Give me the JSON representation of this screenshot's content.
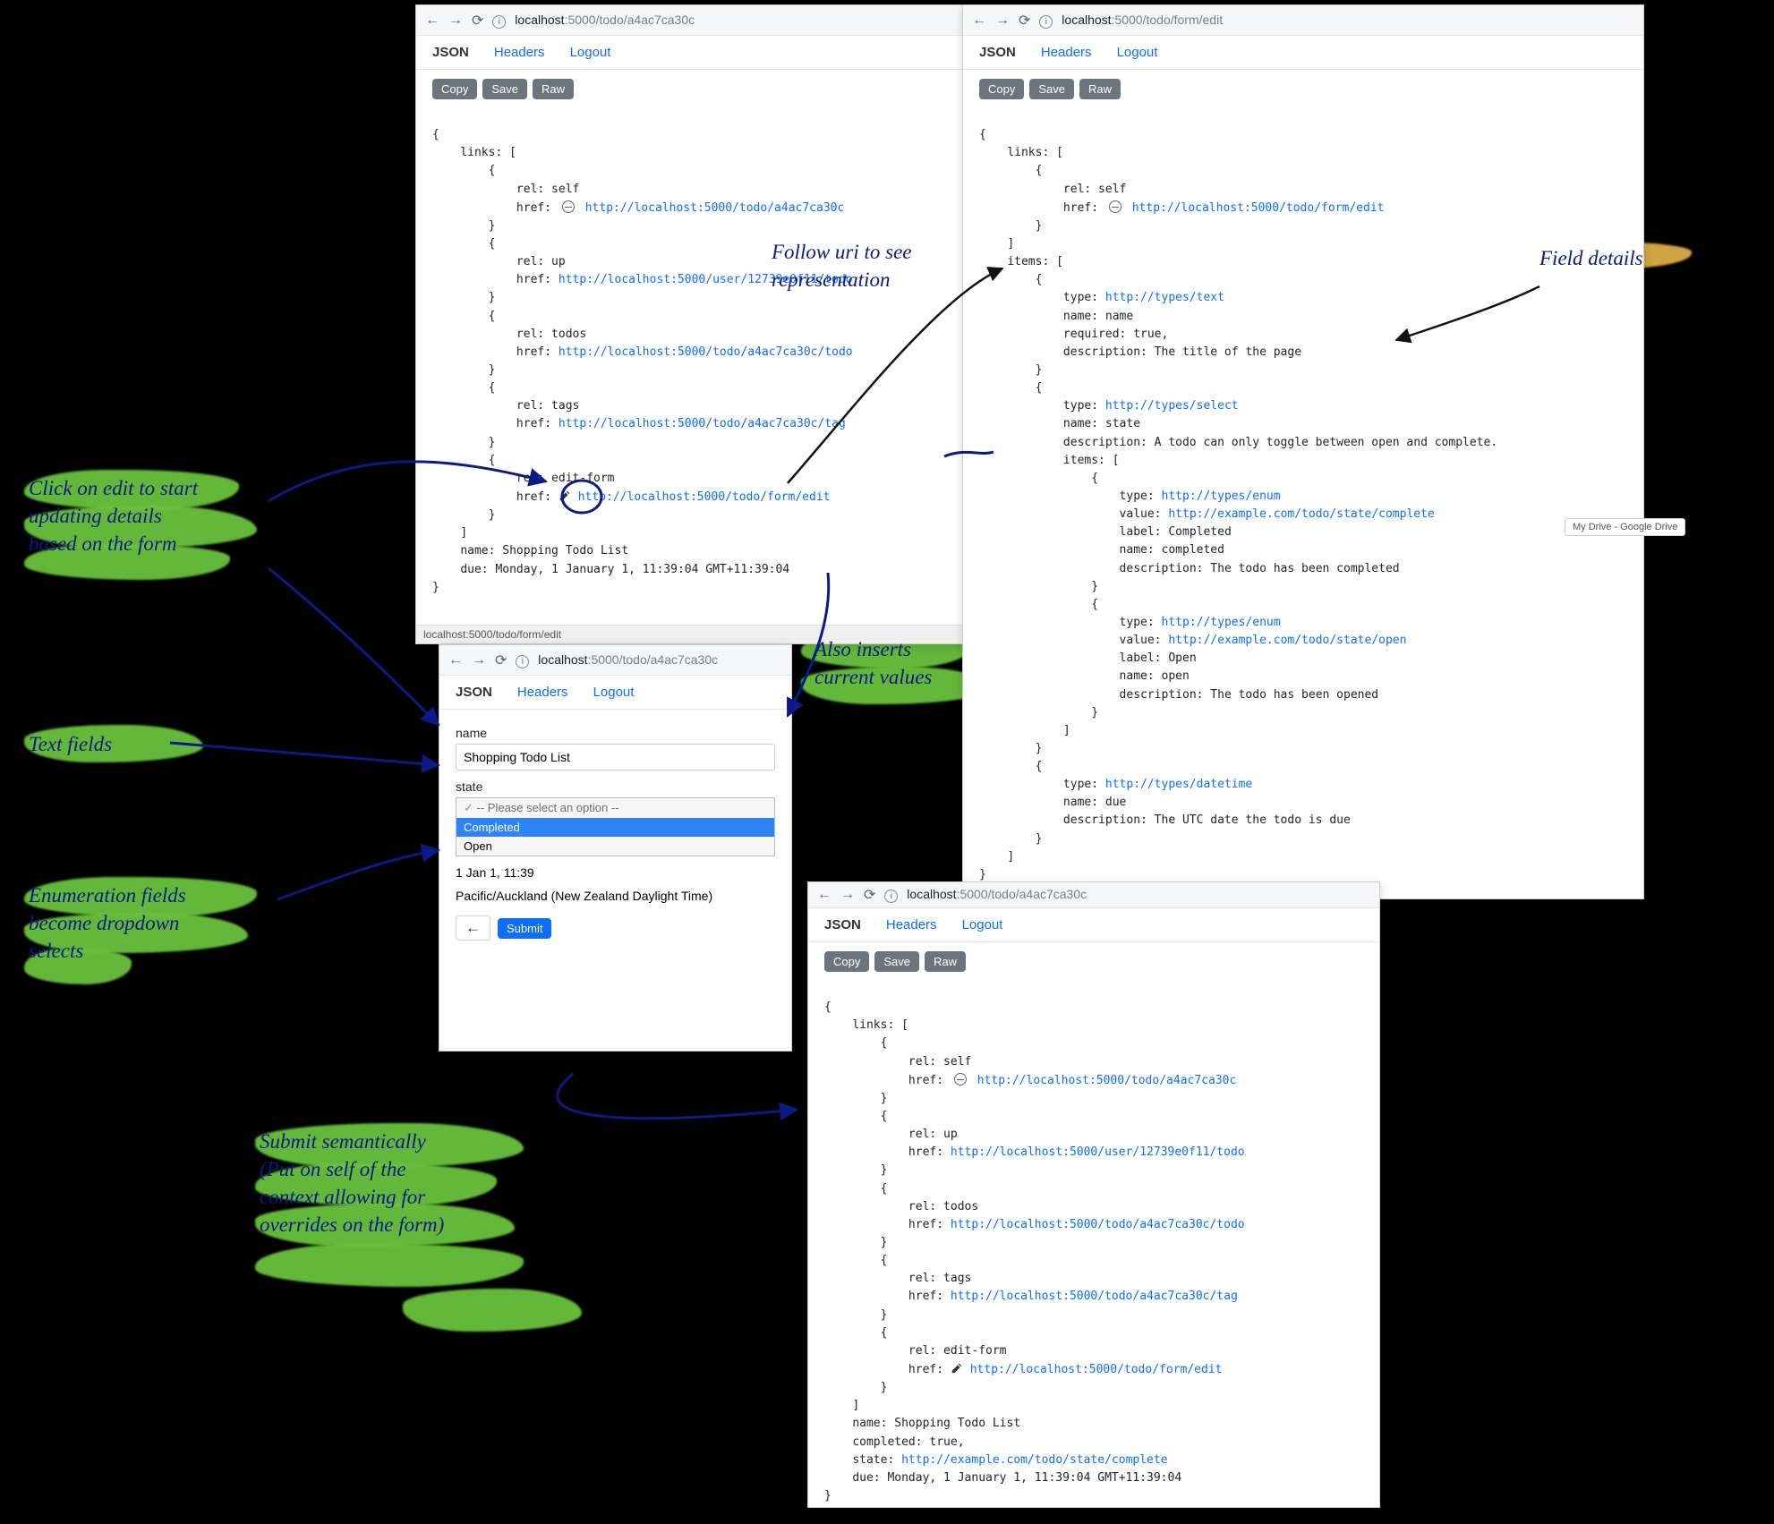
{
  "windows": {
    "w1": {
      "url_host": "localhost",
      "url_path": ":5000/todo/a4ac7ca30c",
      "tabs": {
        "json": "JSON",
        "headers": "Headers",
        "logout": "Logout"
      },
      "buttons": {
        "copy": "Copy",
        "save": "Save",
        "raw": "Raw"
      },
      "json": {
        "open": "{",
        "links_label": "links: [",
        "link_open": "{",
        "link_close": "}",
        "rel_self": "rel: self",
        "href_self_pre": "href:",
        "href_self": "http://localhost:5000/todo/a4ac7ca30c",
        "rel_up": "rel: up",
        "href_up_pre": "href:",
        "href_up": "http://localhost:5000/user/12739e0f11/todo",
        "rel_todos": "rel: todos",
        "href_todos_pre": "href:",
        "href_todos": "http://localhost:5000/todo/a4ac7ca30c/todo",
        "rel_tags": "rel: tags",
        "href_tags_pre": "href:",
        "href_tags": "http://localhost:5000/todo/a4ac7ca30c/tag",
        "rel_edit": "rel: edit-form",
        "href_edit_pre": "href:",
        "href_edit": "http://localhost:5000/todo/form/edit",
        "links_close": "]",
        "name_line": "name: Shopping Todo List",
        "due_line": "due: Monday, 1 January 1, 11:39:04 GMT+11:39:04",
        "close": "}"
      },
      "status": "localhost:5000/todo/form/edit"
    },
    "w2": {
      "url_host": "localhost",
      "url_path": ":5000/todo/form/edit",
      "tabs": {
        "json": "JSON",
        "headers": "Headers",
        "logout": "Logout"
      },
      "buttons": {
        "copy": "Copy",
        "save": "Save",
        "raw": "Raw"
      },
      "json": {
        "open": "{",
        "links_label": "links: [",
        "link_open": "{",
        "link_close": "}",
        "rel_self": "rel: self",
        "href_self_pre": "href:",
        "href_self": "http://localhost:5000/todo/form/edit",
        "links_close": "]",
        "items_label": "items: [",
        "item1_type_pre": "type:",
        "item1_type": "http://types/text",
        "item1_name": "name: name",
        "item1_req": "required: true,",
        "item1_desc": "description: The title of the page",
        "item2_type_pre": "type:",
        "item2_type": "http://types/select",
        "item2_name": "name: state",
        "item2_desc": "description: A todo can only toggle between open and complete.",
        "item2_items_label": "items: [",
        "enum1_type_pre": "type:",
        "enum1_type": "http://types/enum",
        "enum1_value_pre": "value:",
        "enum1_value": "http://example.com/todo/state/complete",
        "enum1_label": "label: Completed",
        "enum1_name": "name: completed",
        "enum1_desc": "description: The todo has been completed",
        "enum2_type_pre": "type:",
        "enum2_type": "http://types/enum",
        "enum2_value_pre": "value:",
        "enum2_value": "http://example.com/todo/state/open",
        "enum2_label": "label: Open",
        "enum2_name": "name: open",
        "enum2_desc": "description: The todo has been opened",
        "item2_items_close": "]",
        "item3_type_pre": "type:",
        "item3_type": "http://types/datetime",
        "item3_name": "name: due",
        "item3_desc": "description: The UTC date the todo is due",
        "items_close": "]",
        "close": "}"
      }
    },
    "w3": {
      "url_host": "localhost",
      "url_path": ":5000/todo/a4ac7ca30c",
      "tabs": {
        "json": "JSON",
        "headers": "Headers",
        "logout": "Logout"
      },
      "form": {
        "name_label": "name",
        "name_value": "Shopping Todo List",
        "state_label": "state",
        "state_placeholder": "-- Please select an option --",
        "state_opt_completed": "Completed",
        "state_opt_open": "Open",
        "date_value": "1 Jan 1, 11:39",
        "tz_value": "Pacific/Auckland (New Zealand Daylight Time)",
        "back_icon": "←",
        "submit": "Submit"
      }
    },
    "w4": {
      "url_host": "localhost",
      "url_path": ":5000/todo/a4ac7ca30c",
      "tabs": {
        "json": "JSON",
        "headers": "Headers",
        "logout": "Logout"
      },
      "buttons": {
        "copy": "Copy",
        "save": "Save",
        "raw": "Raw"
      },
      "json": {
        "open": "{",
        "links_label": "links: [",
        "link_open": "{",
        "link_close": "}",
        "rel_self": "rel: self",
        "href_self_pre": "href:",
        "href_self": "http://localhost:5000/todo/a4ac7ca30c",
        "rel_up": "rel: up",
        "href_up_pre": "href:",
        "href_up": "http://localhost:5000/user/12739e0f11/todo",
        "rel_todos": "rel: todos",
        "href_todos_pre": "href:",
        "href_todos": "http://localhost:5000/todo/a4ac7ca30c/todo",
        "rel_tags": "rel: tags",
        "href_tags_pre": "href:",
        "href_tags": "http://localhost:5000/todo/a4ac7ca30c/tag",
        "rel_edit": "rel: edit-form",
        "href_edit_pre": "href:",
        "href_edit": "http://localhost:5000/todo/form/edit",
        "links_close": "]",
        "name_line": "name: Shopping Todo List",
        "completed_line": "completed: true,",
        "state_pre": "state:",
        "state_val": "http://example.com/todo/state/complete",
        "due_line": "due: Monday, 1 January 1, 11:39:04 GMT+11:39:04",
        "close": "}"
      }
    }
  },
  "gdrive": "My Drive - Google Drive",
  "annotations": {
    "follow_uri": "Follow uri to see\nrepresentation",
    "field_details": "Field details",
    "click_edit": "Click on edit to start\nupdating  details\nbased on the form",
    "also_inserts": "Also inserts\ncurrent values",
    "text_fields": "Text fields",
    "enum_fields": "Enumeration fields\nbecome dropdown\nselects",
    "submit_sem": "Submit semantically\n(Put on self of the\ncontext  allowing for\noverrides on the form)"
  }
}
